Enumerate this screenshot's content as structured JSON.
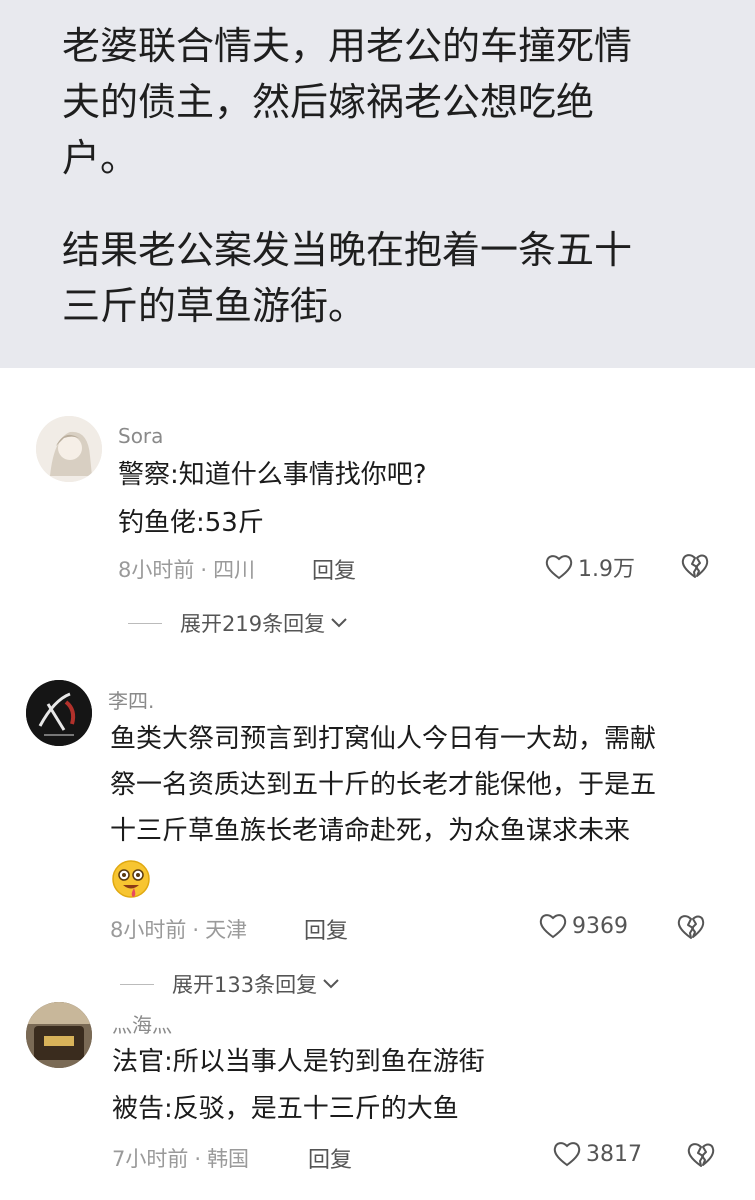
{
  "post": {
    "lines": [
      "老婆联合情夫，用老公的车撞死情",
      "夫的债主，然后嫁祸老公想吃绝",
      "户。",
      "结果老公案发当晚在抱着一条五十",
      "三斤的草鱼游街。"
    ]
  },
  "comments": [
    {
      "user": "Sora",
      "lines": [
        "警察:知道什么事情找你吧?",
        "钓鱼佬:53斤"
      ],
      "time": "8小时前",
      "location": "四川",
      "reply": "回复",
      "likes": "1.9万",
      "expand": "展开219条回复"
    },
    {
      "user": "李四.",
      "lines": [
        "鱼类大祭司预言到打窝仙人今日有一大劫，需献",
        "祭一名资质达到五十斤的长老才能保他，于是五",
        "十三斤草鱼族长老请命赴死，为众鱼谋求未来"
      ],
      "time": "8小时前",
      "location": "天津",
      "reply": "回复",
      "likes": "9369",
      "expand": "展开133条回复"
    },
    {
      "user": "灬海灬",
      "lines": [
        "法官:所以当事人是钓到鱼在游街",
        "被告:反驳，是五十三斤的大鱼"
      ],
      "time": "7小时前",
      "location": "韩国",
      "reply": "回复",
      "likes": "3817"
    }
  ],
  "separator": "·",
  "icons": {
    "like": "heart-outline-icon",
    "dislike": "broken-heart-icon",
    "expand": "chevron-down-icon",
    "emoji": "drooling-face-emoji"
  },
  "colors": {
    "post_bg": "#e8e9ee",
    "meta": "#9a9a9a"
  }
}
